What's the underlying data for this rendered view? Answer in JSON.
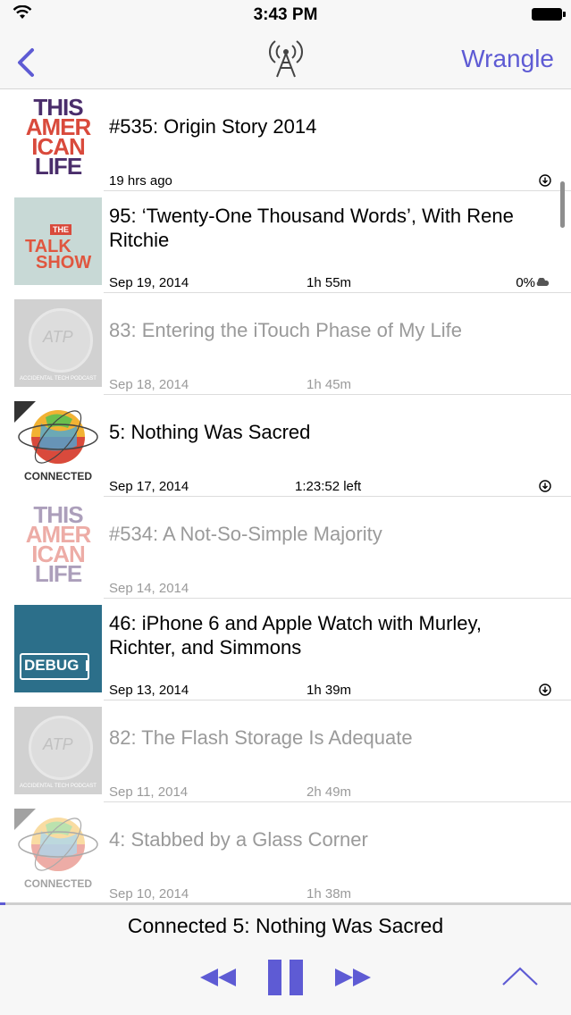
{
  "status_bar": {
    "time": "3:43 PM"
  },
  "nav": {
    "right_label": "Wrangle"
  },
  "colors": {
    "accent": "#5e5bd4",
    "played_text": "#9a9a9a"
  },
  "episodes": [
    {
      "title": "#535: Origin Story 2014",
      "date": "19 hrs ago",
      "duration": "",
      "status": "",
      "artwork": "this-american-life",
      "played": false,
      "download_icon": true
    },
    {
      "title": "95: ‘Twenty-One Thousand Words’, With Rene Ritchie",
      "date": "Sep 19, 2014",
      "duration": "1h 55m",
      "status": "0%",
      "artwork": "the-talk-show",
      "played": false,
      "download_icon": false,
      "cloud_icon": true
    },
    {
      "title": "83: Entering the iTouch Phase of My Life",
      "date": "Sep 18, 2014",
      "duration": "1h 45m",
      "status": "",
      "artwork": "accidental-tech-podcast",
      "played": true,
      "download_icon": false
    },
    {
      "title": "5: Nothing Was Sacred",
      "date": "Sep 17, 2014",
      "duration": "1:23:52 left",
      "status": "",
      "artwork": "connected",
      "played": false,
      "download_icon": true
    },
    {
      "title": "#534: A Not-So-Simple Majority",
      "date": "Sep 14, 2014",
      "duration": "",
      "status": "",
      "artwork": "this-american-life",
      "played": true,
      "download_icon": false
    },
    {
      "title": "46: iPhone 6 and Apple Watch with Murley, Richter, and Simmons",
      "date": "Sep 13, 2014",
      "duration": "1h 39m",
      "status": "",
      "artwork": "debug",
      "played": false,
      "download_icon": true
    },
    {
      "title": "82: The Flash Storage Is Adequate",
      "date": "Sep 11, 2014",
      "duration": "2h 49m",
      "status": "",
      "artwork": "accidental-tech-podcast",
      "played": true,
      "download_icon": false
    },
    {
      "title": "4: Stabbed by a Glass Corner",
      "date": "Sep 10, 2014",
      "duration": "1h 38m",
      "status": "",
      "artwork": "connected",
      "played": true,
      "download_icon": false
    }
  ],
  "artwork_text": {
    "tal_lines": [
      "THIS",
      "AMER",
      "ICAN",
      "LIFE"
    ],
    "talk_show_lines": [
      "THE",
      "TALK",
      "SHOW"
    ],
    "atp_label": "ACCIDENTAL TECH PODCAST",
    "atp_mark": "ATP",
    "connected_label": "CONNECTED",
    "debug_label": "DEBUG"
  },
  "player": {
    "now_playing": "Connected 5: Nothing Was Sacred",
    "progress": 0.01
  }
}
